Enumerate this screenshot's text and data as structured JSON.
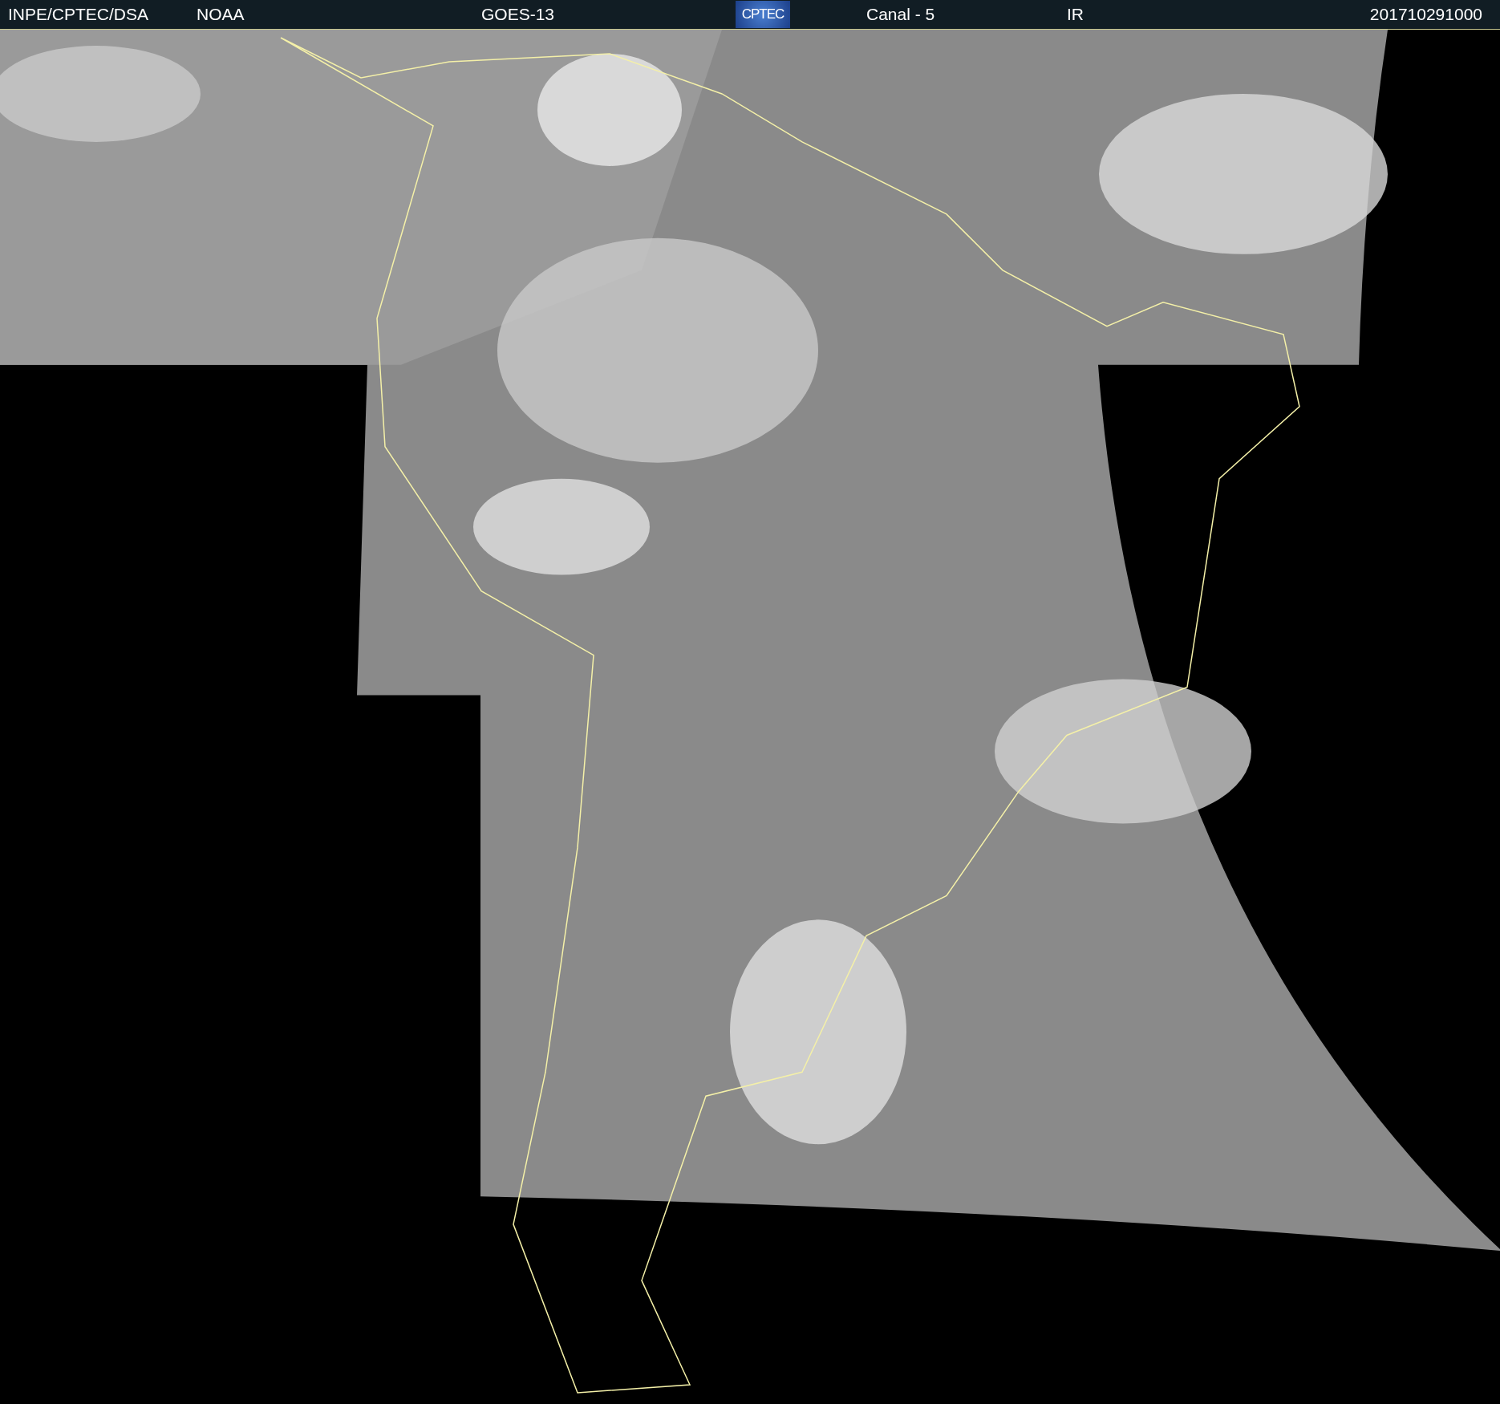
{
  "header": {
    "source": "INPE/CPTEC/DSA",
    "agency": "NOAA",
    "satellite": "GOES-13",
    "logo": "CPTEC",
    "channel": "Canal - 5",
    "band": "IR",
    "timestamp": "201710291000"
  }
}
